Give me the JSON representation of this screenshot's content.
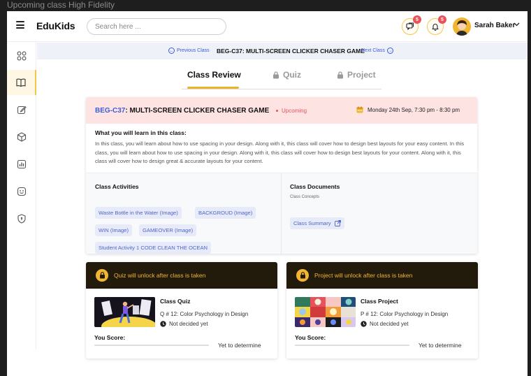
{
  "frame_title": "Upcoming class High Fidelity",
  "header": {
    "logo": "EduKids",
    "search_placeholder": "Search here ...",
    "messages_count": "5",
    "notifications_count": "5",
    "user_name": "Sarah Baker"
  },
  "sidebar": {
    "items": [
      {
        "icon": "grid-icon"
      },
      {
        "icon": "book-icon",
        "active": true
      },
      {
        "icon": "edit-icon"
      },
      {
        "icon": "cube-icon"
      },
      {
        "icon": "chart-icon"
      },
      {
        "icon": "smile-icon"
      },
      {
        "icon": "shield-icon"
      }
    ]
  },
  "lesson_nav": {
    "prev_label": "Previous Class",
    "title": "BEG-C37: MULTI-SCREEN CLICKER CHASER GAME",
    "next_label": "Next Class"
  },
  "tabs": [
    {
      "label": "Class Review",
      "active": true,
      "locked": false
    },
    {
      "label": "Quiz",
      "active": false,
      "locked": true
    },
    {
      "label": "Project",
      "active": false,
      "locked": true
    }
  ],
  "class_card": {
    "code": "BEG-C37",
    "title": ": MULTI-SCREEN CLICKER CHASER GAME",
    "status": "Upcoming",
    "date": "Monday 24th Sep, 7:30 pm - 8:30 pm",
    "learn_title": "What you will learn in this class:",
    "learn_text": "In this class, you will learn about how to use spacing in your design. Along with it, this class will cover how to design best layouts for your easy content. In this class, you will learn about how to use spacing in your design. Along with it, this class will cover how to design best layouts for your content. Along with it, this class will cover how to design great & accurate layouts for  your content.",
    "activities_title": "Class Activities",
    "activities": [
      "Waste Bottle in the Water (Image)",
      "BACKGROUD (Image)",
      "WIN (Image)",
      "GAMEOVER (Image)",
      "Student Activity 1 CODE CLEAN THE OCEAN"
    ],
    "documents_title": "Class Documents",
    "documents_subtitle": "Class Concepts",
    "documents": [
      "Class Summary"
    ]
  },
  "quiz_card": {
    "lock_message": "Quiz will unlock after class is taken",
    "title": "Class Quiz",
    "subtitle": "Q # 12: Color Psychology in Design",
    "schedule": "Not decided yet",
    "score_label": "You Score:",
    "score_value": "Yet to determine"
  },
  "project_card": {
    "lock_message": "Project will unlock after class is taken",
    "title": "Class Project",
    "subtitle": "P # 12: Color Psychology in Design",
    "schedule": "Not decided yet",
    "score_label": "You Score:",
    "score_value": "Yet to determine"
  },
  "colors": {
    "accent": "#f2b531",
    "link": "#3b5bdb",
    "status": "#e8525b",
    "header_pink": "#fde4e3",
    "lock_banner": "#221a0b"
  }
}
